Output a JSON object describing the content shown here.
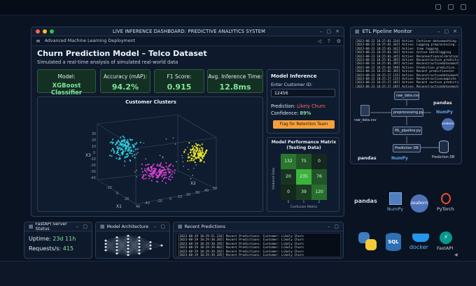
{
  "main_window": {
    "title": "LIVE INFERENCE DASHBOARD: PREDICTIVE ANALYTICS SYSTEM",
    "menu_label": "Advanced Machine Learning Deployment",
    "heading": "Churn Prediction Model – Telco Dataset",
    "subheading": "Simulated a real-time analysis of simulated real-world data"
  },
  "metrics": [
    {
      "label": "Model:",
      "value": "XGBoost Classifier"
    },
    {
      "label": "Accuracy (mAP):",
      "value": "94.2%"
    },
    {
      "label": "F1 Score:",
      "value": "0.915"
    },
    {
      "label": "Avg. Inference Time:",
      "value": "12.8ms"
    }
  ],
  "clusters": {
    "title": "Customer Clusters",
    "axis_x1": "X1",
    "axis_x2": "X2",
    "axis_x3": "X3",
    "x1_ticks": [
      "-20",
      "0",
      "20",
      "40"
    ],
    "x2_ticks": [
      "-40",
      "-20",
      "0",
      "10",
      "20",
      "30",
      "40",
      "50"
    ],
    "x3_ticks": [
      "30",
      "20",
      "10",
      "0",
      "-10",
      "-20",
      "-30",
      "-40"
    ]
  },
  "inference": {
    "title": "Model Inference",
    "field_label": "Enter Customer ID:",
    "customer_id": "12456",
    "prediction_label": "Prediction:",
    "prediction_value": "Likely Churn",
    "confidence_label": "Confidence:",
    "confidence_value": "89%",
    "flag_button": "Flag for Retention Team"
  },
  "confusion": {
    "title_line1": "Model Performance Matrix",
    "title_line2": "(Testing Data)",
    "ylabel": "Visibend Data",
    "xlabel": "Confusion Matrix",
    "rows": [
      [
        "132",
        "75",
        "0"
      ],
      [
        "20",
        "235",
        "76"
      ],
      [
        "0",
        "39",
        "120"
      ]
    ],
    "col_ticks": [
      "0",
      "1",
      "2"
    ]
  },
  "etl": {
    "title": "ETL Pipeline Monitor",
    "logs": [
      "[2023-08-23 10:25:01.234] Active: Continue datasmoothing ...",
      "[2023-08-23 10:25:01.342] Active: Logging preprocessing...",
      "[2023-08-23 10:25:01.342] Active: time logging",
      "[2023-08-23 10:25:01.342] Active: Active batchlogging",
      "[2023-08-23 10:25:01.345] Active: Reconnectioncalibration",
      "[2023-08-23 10:25:01.395] Active: Reconstruction prediction",
      "[2023-08-23 10:25:01.395] Active: Reconstructiondatasmooth",
      "[2023-08-23 10:25:01.598] Active: Prediction prediction...",
      "[2023-08-23 10:25:02.395] Active: Recent predictionster",
      "[2023-08-23 10:25:27.135] Active: Reconstructiondatasmooth",
      "[2023-08-23 10:25:27.135] Active: Reconstructioncomplete",
      "[2023-08-23 10:25:27.185] Active: Recent section prediction",
      "[2023-08-23 10:25:27.185] Active: Reconstructiondatasmooth"
    ],
    "nodes": {
      "raw_csv": "raw_data.csv",
      "raw_file": "raw_data.csv",
      "preprocess": "preprocessing.py",
      "ml_pipeline": "ML_pipeline.py",
      "prediction_db": "Prediction DB",
      "prediction_db_label": "Prediction DB"
    },
    "logos": {
      "pandas": "pandas",
      "numpy": "NumPy",
      "seaborn": "seaborn"
    }
  },
  "fastapi_panel": {
    "title": "FastAPI Server Status",
    "uptime_label": "Uptime:",
    "uptime_value": "23d 11h",
    "requests_label": "Requests/s:",
    "requests_value": "415"
  },
  "architecture_panel": {
    "title": "Model Architecture"
  },
  "predictions_panel": {
    "title": "Recent Predictions",
    "logs": [
      "[2023-08-29 10:29:51.234] Recent Predictions: Customer: Likely Churn",
      "[2023-08-29 10:29:38.202] Recent Predictions: Customer: Likely Churn",
      "[2023-08-29 10:29:38.285] Recent Predictions: Customer: Likely Churn",
      "[2023-08-29 10:29:39.002] Recent Predictions: Customer: Likely Churn",
      "[2023-08-29 10:29:39.282] Recent Predictions: Customer: Likely Churn",
      "[2023-08-29 10:29:39.285] Recent Predictions: Customer: Likely Churn"
    ]
  },
  "tech_logos": {
    "pandas": "pandas",
    "numpy": "NumPy",
    "seaborn": "seaborn",
    "pytorch": "PyTorch",
    "sql": "SQL",
    "docker": "docker",
    "fastapi": "FastAPI"
  },
  "colors": {
    "accent_green": "#7ee59c",
    "churn_red": "#ff6a6a",
    "flag_orange": "#f5a03c",
    "cyan": "#2fd3e6",
    "magenta": "#e13fd8",
    "yellow": "#f2ee2a"
  }
}
